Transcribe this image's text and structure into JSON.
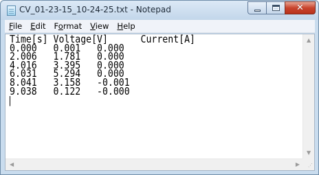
{
  "window": {
    "title": "CV_01-23-15_10-24-25.txt - Notepad",
    "icon": "notepad-icon"
  },
  "menu": [
    {
      "accel": "F",
      "rest": "ile"
    },
    {
      "accel": "E",
      "rest": "dit"
    },
    {
      "pre": "F",
      "accel": "o",
      "rest": "rmat"
    },
    {
      "accel": "V",
      "rest": "iew"
    },
    {
      "accel": "H",
      "rest": "elp"
    }
  ],
  "content": {
    "lines": [
      "Time[s] Voltage[V]      Current[A]",
      "0.000   0.001   0.000",
      "2.006   1.781   0.000",
      "4.016   3.395   0.000",
      "6.031   5.294   0.000",
      "8.041   3.158   -0.001",
      "9.038   0.122   -0.000"
    ]
  },
  "scrollbars": {
    "up": "▲",
    "down": "▼",
    "left": "◀",
    "right": "▶",
    "grip": "⋰"
  },
  "colors": {
    "titlebar": "#c9dcee",
    "close_button": "#c9452e",
    "menubar": "#f0f3f9"
  }
}
